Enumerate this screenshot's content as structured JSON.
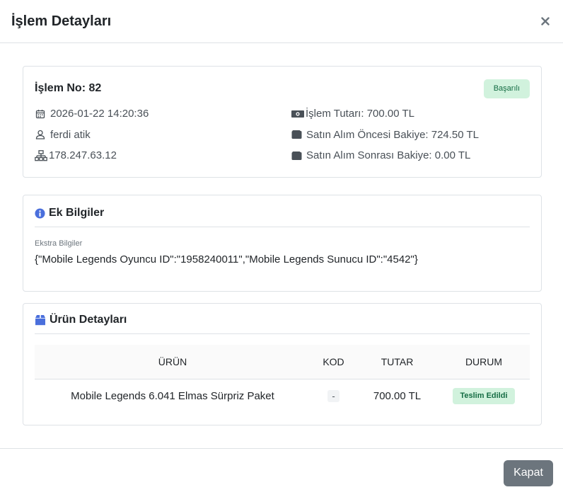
{
  "modal": {
    "title": "İşlem Detayları",
    "close_label": "Kapat"
  },
  "transaction": {
    "title": "İşlem No: 82",
    "status": "Başarılı",
    "date": "2026-01-22 14:20:36",
    "user": "ferdi atik",
    "ip": "178.247.63.12",
    "amount": "İşlem Tutarı: 700.00 TL",
    "balance_before": "Satın Alım Öncesi Bakiye: 724.50 TL",
    "balance_after": "Satın Alım Sonrası Bakiye: 0.00 TL"
  },
  "extra": {
    "title": "Ek Bilgiler",
    "label": "Ekstra Bilgiler",
    "value": "{\"Mobile Legends Oyuncu ID\":\"1958240011\",\"Mobile Legends Sunucu ID\":\"4542\"}"
  },
  "products": {
    "title": "Ürün Detayları",
    "columns": [
      "ÜRÜN",
      "KOD",
      "TUTAR",
      "DURUM"
    ],
    "rows": [
      {
        "product": "Mobile Legends 6.041 Elmas Sürpriz Paket",
        "code": "-",
        "amount": "700.00 TL",
        "status": "Teslim Edildi"
      }
    ]
  },
  "colors": {
    "success_bg": "#d1f2dd",
    "success_text": "#146c43",
    "icon_blue": "#4a6fdc",
    "button_gray": "#6c757d"
  },
  "icons": [
    "close-icon",
    "calendar-icon",
    "user-icon",
    "network-icon",
    "money-icon",
    "wallet-icon",
    "info-icon",
    "box-icon"
  ]
}
